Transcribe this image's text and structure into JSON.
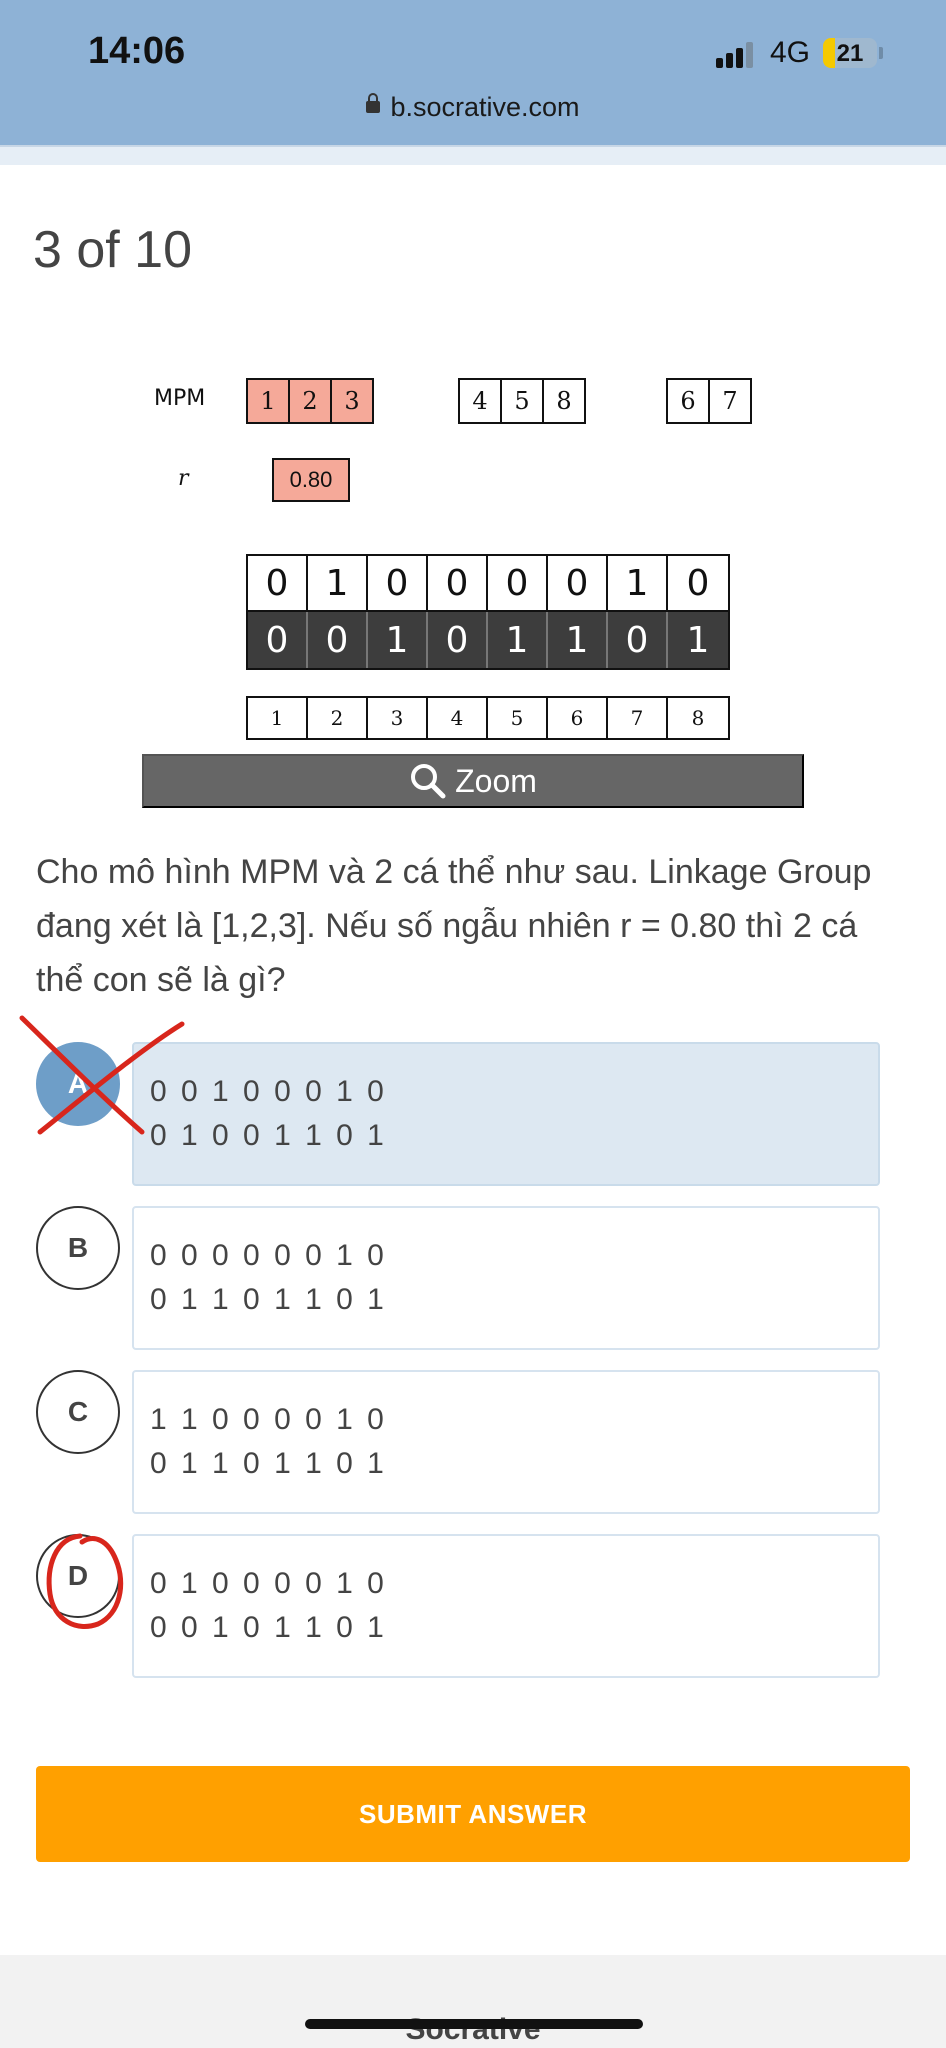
{
  "status_bar": {
    "time": "14:06",
    "network": "4G",
    "battery": "21",
    "url": "b.socrative.com"
  },
  "quiz": {
    "counter": "3 of 10",
    "zoom_label": "Zoom",
    "question": "Cho mô hình MPM và 2 cá thể như sau. Linkage Group đang xét là [1,2,3]. Nếu số ngẫu nhiên r = 0.80 thì 2 cá thể con sẽ là gì?",
    "submit_label": "SUBMIT ANSWER"
  },
  "figure": {
    "mpm_label": "MPM",
    "r_label": "r",
    "group1": [
      "1",
      "2",
      "3"
    ],
    "group2": [
      "4",
      "5",
      "8"
    ],
    "group3": [
      "6",
      "7"
    ],
    "r_value": "0.80",
    "parent1": [
      "0",
      "1",
      "0",
      "0",
      "0",
      "0",
      "1",
      "0"
    ],
    "parent2": [
      "0",
      "0",
      "1",
      "0",
      "1",
      "1",
      "0",
      "1"
    ],
    "indices": [
      "1",
      "2",
      "3",
      "4",
      "5",
      "6",
      "7",
      "8"
    ]
  },
  "options": [
    {
      "letter": "A",
      "line1": "0 0 1 0 0 0 1 0",
      "line2": "0 1 0 0 1  1 0 1",
      "selected": true
    },
    {
      "letter": "B",
      "line1": "0 0 0 0 0 0 1 0",
      "line2": "0 1  1 0 1  1 0 1",
      "selected": false
    },
    {
      "letter": "C",
      "line1": "1  1 0 0 0 0 1 0",
      "line2": "0 1  1 0 1  1 0 1",
      "selected": false
    },
    {
      "letter": "D",
      "line1": "0 1 0 0 0 0 1 0",
      "line2": "0 0 1 0 1  1 0 1",
      "selected": false
    }
  ],
  "footer": {
    "brand": "Socrative"
  },
  "colors": {
    "status_bar": "#8eb2d6",
    "selected_option": "#6e9ec8",
    "submit": "#ffa000",
    "annotation": "#d8261c",
    "mpm_highlight": "#f5a999"
  }
}
